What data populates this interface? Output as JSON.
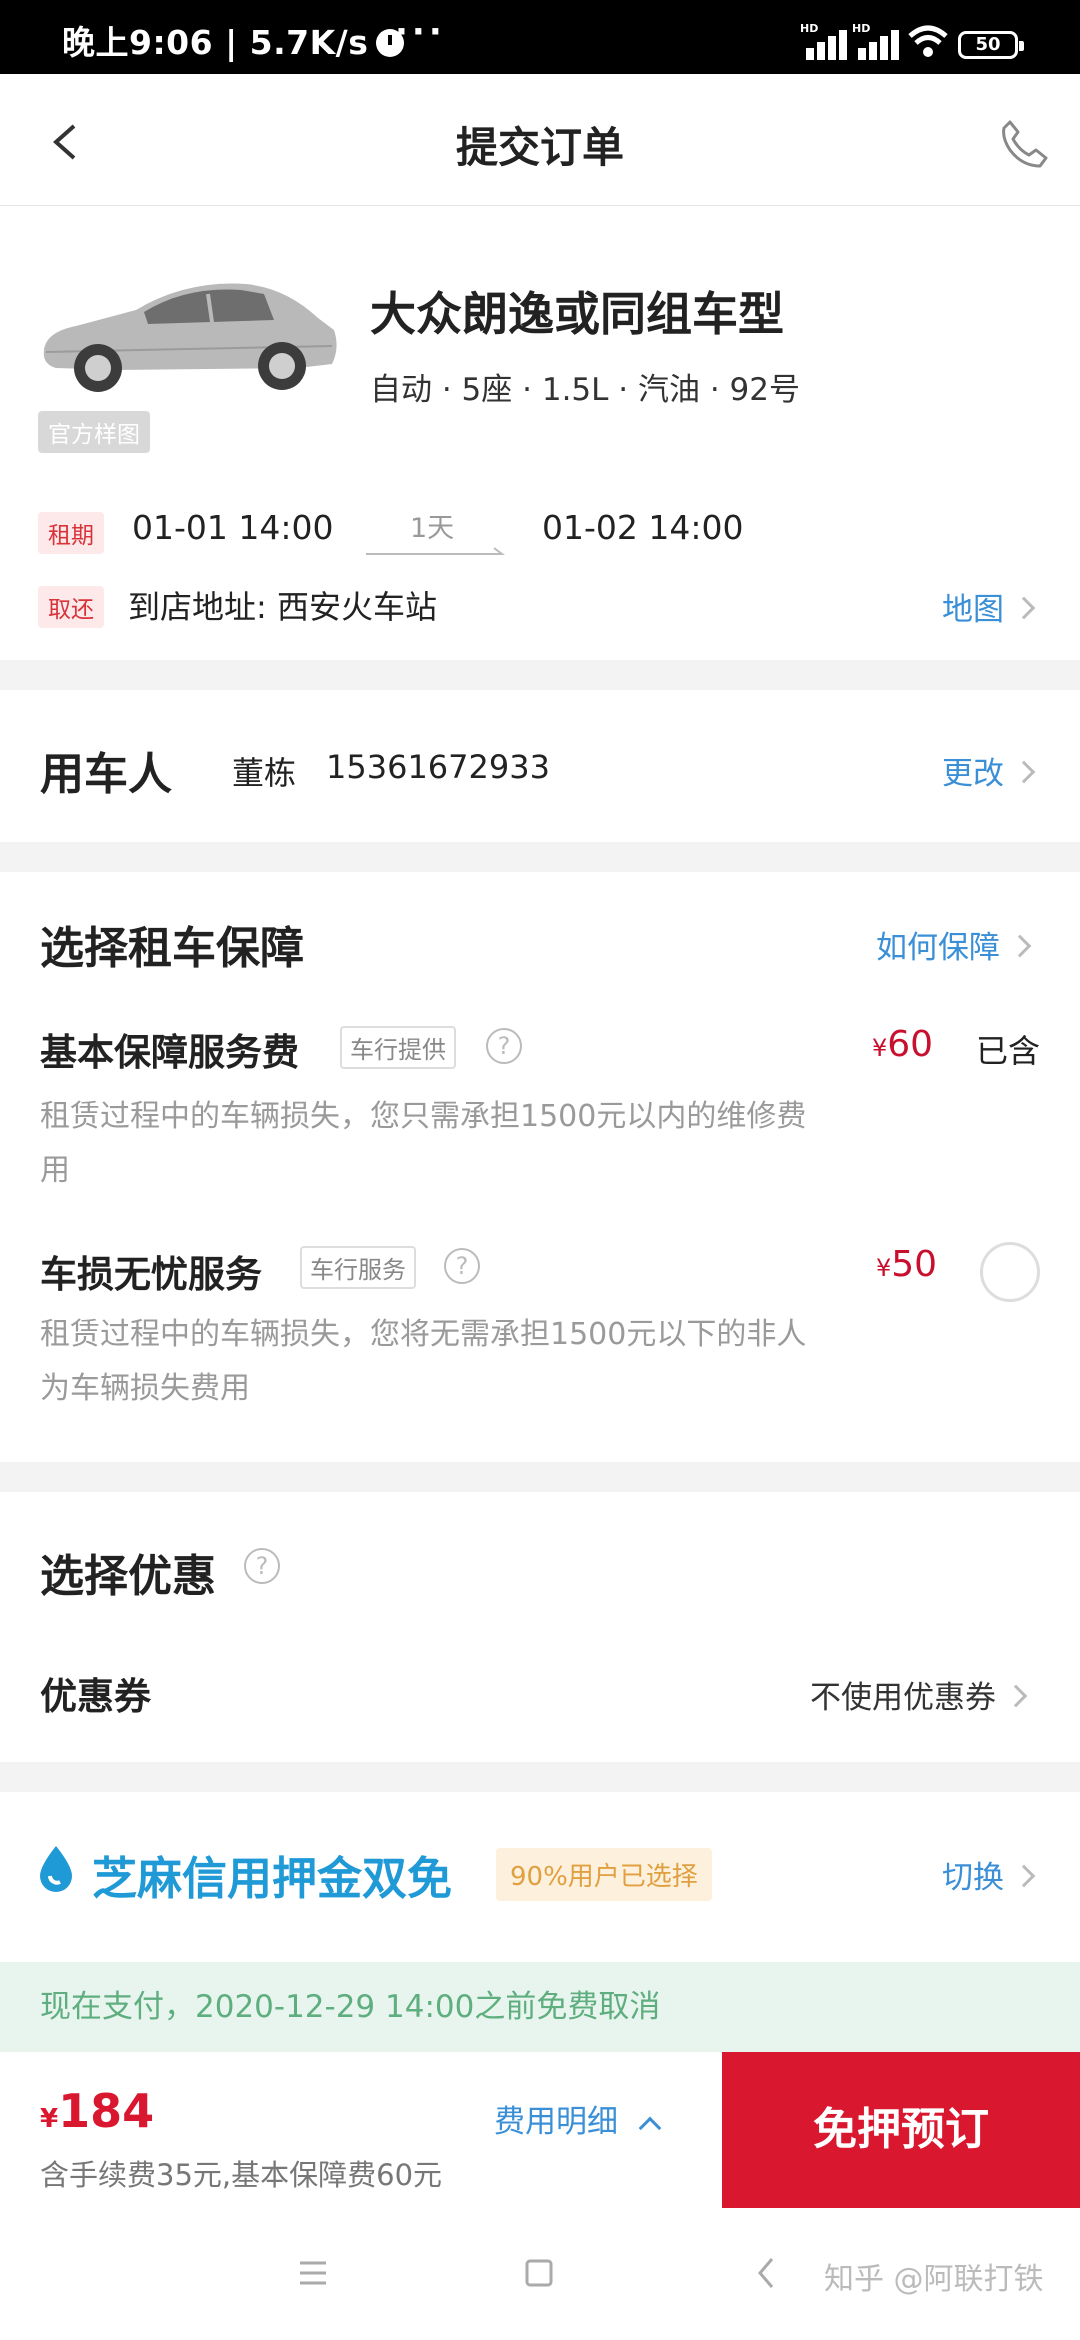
{
  "status": {
    "time": "晚上9:06 | 5.7K/s",
    "more": "···",
    "battery": "50",
    "hd1": "HD",
    "hd2": "HD"
  },
  "header": {
    "title": "提交订单"
  },
  "car": {
    "name": "大众朗逸或同组车型",
    "specs": "自动 · 5座 · 1.5L · 汽油 · 92号",
    "image_tag": "官方样图",
    "rent_label": "租期",
    "start": "01-01 14:00",
    "duration": "1天",
    "end": "01-02 14:00",
    "pickup_label": "取还",
    "address": "到店地址: 西安火车站",
    "map_link": "地图"
  },
  "driver": {
    "label": "用车人",
    "name": "董栋",
    "phone": "15361672933",
    "change": "更改"
  },
  "insurance": {
    "title": "选择租车保障",
    "how_link": "如何保障",
    "items": [
      {
        "title": "基本保障服务费",
        "tag": "车行提供",
        "currency": "¥",
        "price": "60",
        "state": "已含",
        "desc": "租赁过程中的车辆损失，您只需承担1500元以内的维修费用"
      },
      {
        "title": "车损无忧服务",
        "tag": "车行服务",
        "currency": "¥",
        "price": "50",
        "desc": "租赁过程中的车辆损失，您将无需承担1500元以下的非人为车辆损失费用"
      }
    ]
  },
  "discount": {
    "title": "选择优惠",
    "coupon_label": "优惠券",
    "coupon_value": "不使用优惠券"
  },
  "credit": {
    "title": "芝麻信用押金双免",
    "badge": "90%用户已选择",
    "switch": "切换"
  },
  "notice": "现在支付，2020-12-29 14:00之前免费取消",
  "footer": {
    "currency": "¥",
    "total": "184",
    "fee_detail": "费用明细",
    "sub": "含手续费35元,基本保障费60元",
    "cta": "免押预订"
  },
  "watermark": "知乎 @阿联打铁",
  "colors": {
    "accent_red": "#d9172f",
    "link_blue": "#3b8fd6",
    "zhima_blue": "#1f9ad6",
    "notice_green": "#5fae7f"
  }
}
